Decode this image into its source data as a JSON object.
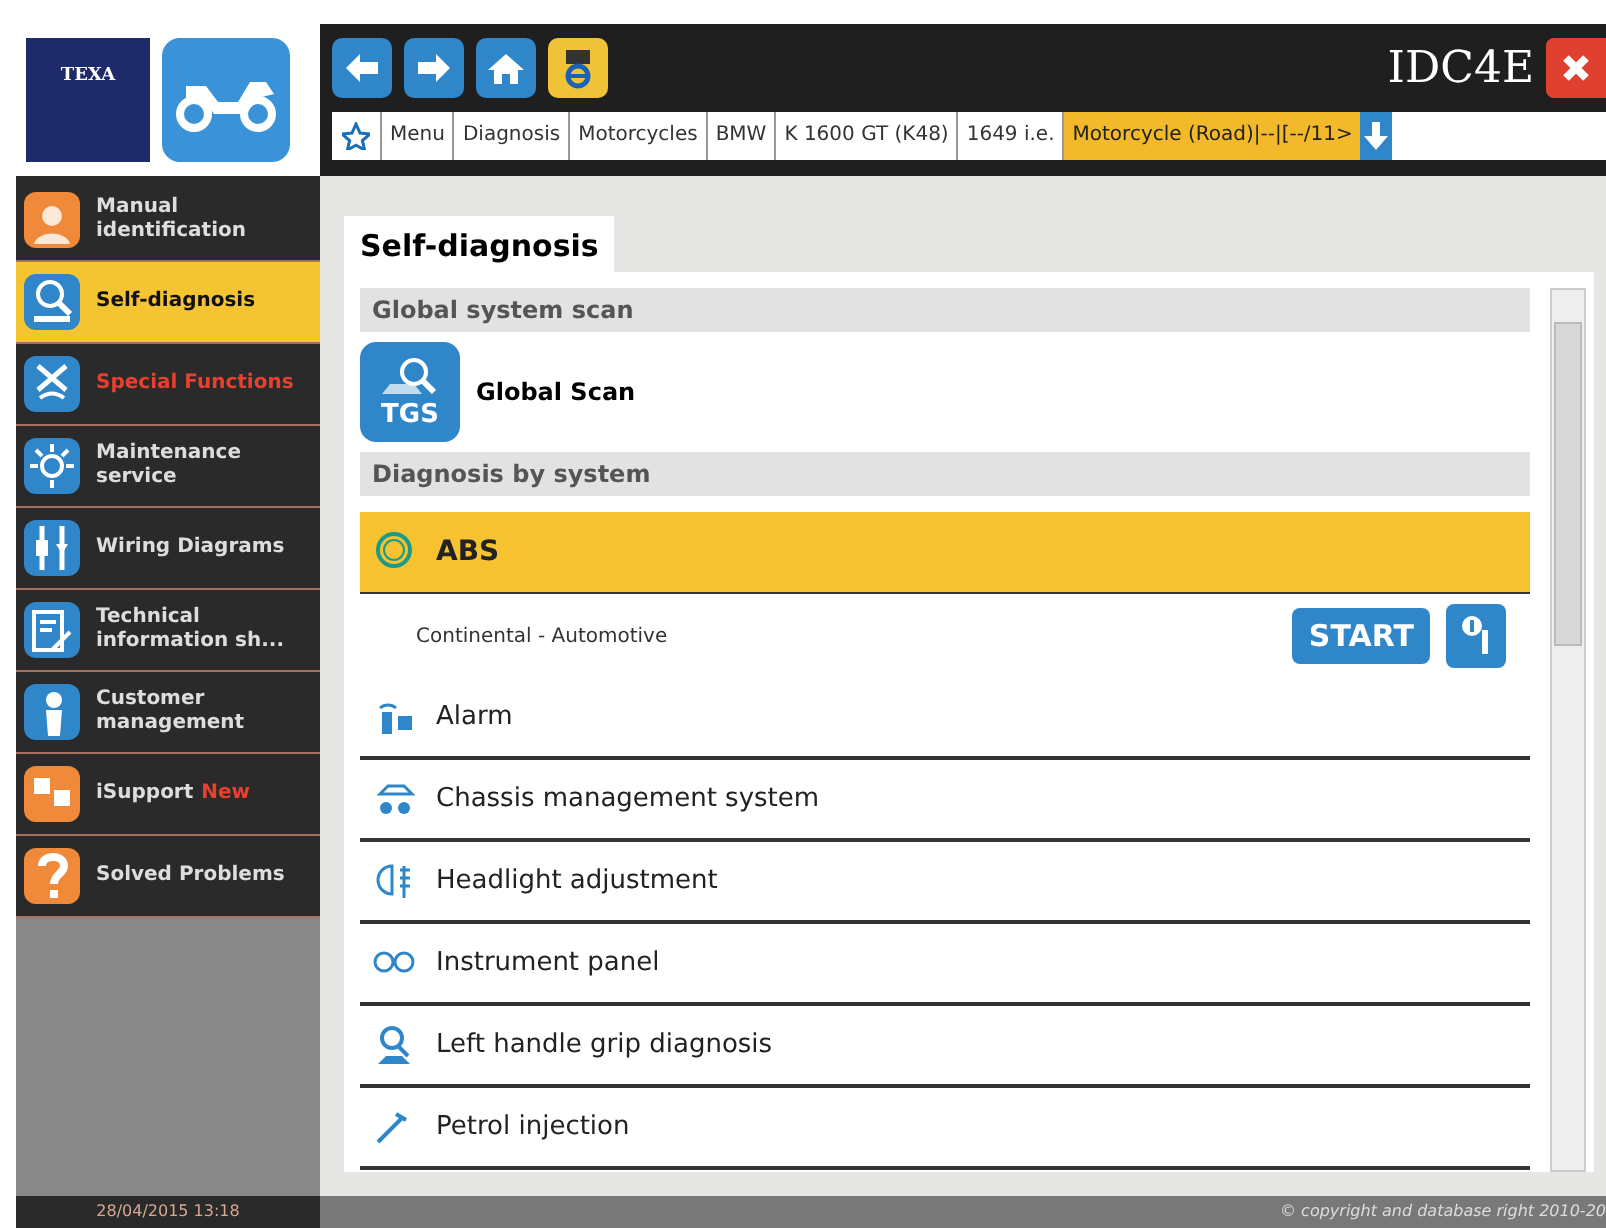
{
  "header": {
    "brand": "TEXA",
    "title": "IDC4E"
  },
  "breadcrumb": [
    {
      "label": "Menu",
      "selected": false
    },
    {
      "label": "Diagnosis",
      "selected": false
    },
    {
      "label": "Motorcycles",
      "selected": false
    },
    {
      "label": "BMW",
      "selected": false
    },
    {
      "label": "K 1600 GT (K48)",
      "selected": false
    },
    {
      "label": "1649 i.e.",
      "selected": false
    },
    {
      "label": "Motorcycle (Road)|--|[--/11>",
      "selected": true
    }
  ],
  "sidebar": {
    "items": [
      {
        "label": "Manual identification",
        "selected": false,
        "alert": false,
        "color": "#f08a3a"
      },
      {
        "label": "Self-diagnosis",
        "selected": true,
        "alert": false,
        "color": "#2f86c8"
      },
      {
        "label": "Special Functions",
        "selected": false,
        "alert": true,
        "color": "#2f86c8"
      },
      {
        "label": "Maintenance service",
        "selected": false,
        "alert": false,
        "color": "#2f86c8"
      },
      {
        "label": "Wiring Diagrams",
        "selected": false,
        "alert": false,
        "color": "#2f86c8"
      },
      {
        "label": "Technical information sh...",
        "selected": false,
        "alert": false,
        "color": "#2f86c8"
      },
      {
        "label": "Customer management",
        "selected": false,
        "alert": false,
        "color": "#2f86c8"
      },
      {
        "label": "iSupport",
        "badge": "New",
        "selected": false,
        "alert": false,
        "color": "#f08a3a"
      },
      {
        "label": "Solved Problems",
        "selected": false,
        "alert": false,
        "color": "#f08a3a"
      }
    ],
    "datetime": "28/04/2015 13:18"
  },
  "page_title": "Self-diagnosis",
  "list": [
    {
      "kind": "section",
      "label": "Global system scan"
    },
    {
      "kind": "scan",
      "label": "Global Scan",
      "badge": "TGS"
    },
    {
      "kind": "section",
      "label": "Diagnosis by system"
    },
    {
      "kind": "system",
      "label": "ABS",
      "selected": true,
      "expanded": true,
      "supplier": "Continental - Automotive",
      "button": "START"
    },
    {
      "kind": "system",
      "label": "Alarm",
      "selected": false,
      "expanded": false
    },
    {
      "kind": "system",
      "label": "Chassis management system",
      "selected": false,
      "expanded": false
    },
    {
      "kind": "system",
      "label": "Headlight adjustment",
      "selected": false,
      "expanded": false
    },
    {
      "kind": "system",
      "label": "Instrument panel",
      "selected": false,
      "expanded": false
    },
    {
      "kind": "system",
      "label": "Left handle grip diagnosis",
      "selected": false,
      "expanded": false
    },
    {
      "kind": "system",
      "label": "Petrol injection",
      "selected": false,
      "expanded": false
    }
  ],
  "copyright": "© copyright and database right 2010-20"
}
